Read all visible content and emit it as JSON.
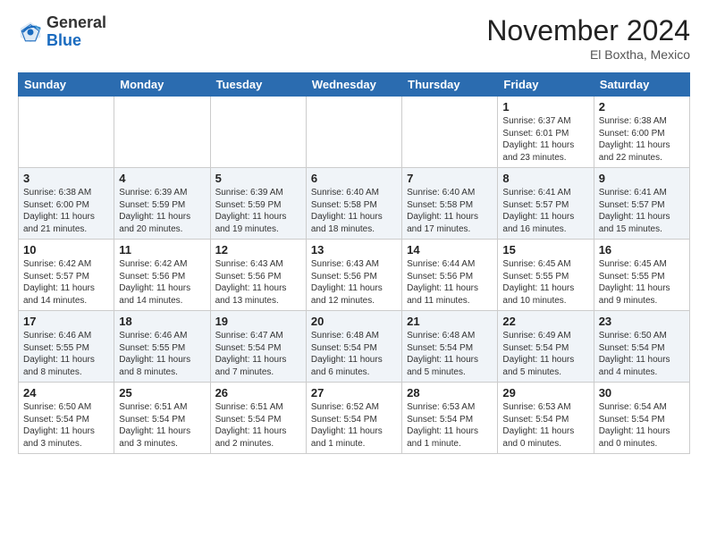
{
  "logo": {
    "general": "General",
    "blue": "Blue"
  },
  "header": {
    "month": "November 2024",
    "location": "El Boxtha, Mexico"
  },
  "weekdays": [
    "Sunday",
    "Monday",
    "Tuesday",
    "Wednesday",
    "Thursday",
    "Friday",
    "Saturday"
  ],
  "weeks": [
    [
      {
        "day": "",
        "info": ""
      },
      {
        "day": "",
        "info": ""
      },
      {
        "day": "",
        "info": ""
      },
      {
        "day": "",
        "info": ""
      },
      {
        "day": "",
        "info": ""
      },
      {
        "day": "1",
        "info": "Sunrise: 6:37 AM\nSunset: 6:01 PM\nDaylight: 11 hours and 23 minutes."
      },
      {
        "day": "2",
        "info": "Sunrise: 6:38 AM\nSunset: 6:00 PM\nDaylight: 11 hours and 22 minutes."
      }
    ],
    [
      {
        "day": "3",
        "info": "Sunrise: 6:38 AM\nSunset: 6:00 PM\nDaylight: 11 hours and 21 minutes."
      },
      {
        "day": "4",
        "info": "Sunrise: 6:39 AM\nSunset: 5:59 PM\nDaylight: 11 hours and 20 minutes."
      },
      {
        "day": "5",
        "info": "Sunrise: 6:39 AM\nSunset: 5:59 PM\nDaylight: 11 hours and 19 minutes."
      },
      {
        "day": "6",
        "info": "Sunrise: 6:40 AM\nSunset: 5:58 PM\nDaylight: 11 hours and 18 minutes."
      },
      {
        "day": "7",
        "info": "Sunrise: 6:40 AM\nSunset: 5:58 PM\nDaylight: 11 hours and 17 minutes."
      },
      {
        "day": "8",
        "info": "Sunrise: 6:41 AM\nSunset: 5:57 PM\nDaylight: 11 hours and 16 minutes."
      },
      {
        "day": "9",
        "info": "Sunrise: 6:41 AM\nSunset: 5:57 PM\nDaylight: 11 hours and 15 minutes."
      }
    ],
    [
      {
        "day": "10",
        "info": "Sunrise: 6:42 AM\nSunset: 5:57 PM\nDaylight: 11 hours and 14 minutes."
      },
      {
        "day": "11",
        "info": "Sunrise: 6:42 AM\nSunset: 5:56 PM\nDaylight: 11 hours and 14 minutes."
      },
      {
        "day": "12",
        "info": "Sunrise: 6:43 AM\nSunset: 5:56 PM\nDaylight: 11 hours and 13 minutes."
      },
      {
        "day": "13",
        "info": "Sunrise: 6:43 AM\nSunset: 5:56 PM\nDaylight: 11 hours and 12 minutes."
      },
      {
        "day": "14",
        "info": "Sunrise: 6:44 AM\nSunset: 5:56 PM\nDaylight: 11 hours and 11 minutes."
      },
      {
        "day": "15",
        "info": "Sunrise: 6:45 AM\nSunset: 5:55 PM\nDaylight: 11 hours and 10 minutes."
      },
      {
        "day": "16",
        "info": "Sunrise: 6:45 AM\nSunset: 5:55 PM\nDaylight: 11 hours and 9 minutes."
      }
    ],
    [
      {
        "day": "17",
        "info": "Sunrise: 6:46 AM\nSunset: 5:55 PM\nDaylight: 11 hours and 8 minutes."
      },
      {
        "day": "18",
        "info": "Sunrise: 6:46 AM\nSunset: 5:55 PM\nDaylight: 11 hours and 8 minutes."
      },
      {
        "day": "19",
        "info": "Sunrise: 6:47 AM\nSunset: 5:54 PM\nDaylight: 11 hours and 7 minutes."
      },
      {
        "day": "20",
        "info": "Sunrise: 6:48 AM\nSunset: 5:54 PM\nDaylight: 11 hours and 6 minutes."
      },
      {
        "day": "21",
        "info": "Sunrise: 6:48 AM\nSunset: 5:54 PM\nDaylight: 11 hours and 5 minutes."
      },
      {
        "day": "22",
        "info": "Sunrise: 6:49 AM\nSunset: 5:54 PM\nDaylight: 11 hours and 5 minutes."
      },
      {
        "day": "23",
        "info": "Sunrise: 6:50 AM\nSunset: 5:54 PM\nDaylight: 11 hours and 4 minutes."
      }
    ],
    [
      {
        "day": "24",
        "info": "Sunrise: 6:50 AM\nSunset: 5:54 PM\nDaylight: 11 hours and 3 minutes."
      },
      {
        "day": "25",
        "info": "Sunrise: 6:51 AM\nSunset: 5:54 PM\nDaylight: 11 hours and 3 minutes."
      },
      {
        "day": "26",
        "info": "Sunrise: 6:51 AM\nSunset: 5:54 PM\nDaylight: 11 hours and 2 minutes."
      },
      {
        "day": "27",
        "info": "Sunrise: 6:52 AM\nSunset: 5:54 PM\nDaylight: 11 hours and 1 minute."
      },
      {
        "day": "28",
        "info": "Sunrise: 6:53 AM\nSunset: 5:54 PM\nDaylight: 11 hours and 1 minute."
      },
      {
        "day": "29",
        "info": "Sunrise: 6:53 AM\nSunset: 5:54 PM\nDaylight: 11 hours and 0 minutes."
      },
      {
        "day": "30",
        "info": "Sunrise: 6:54 AM\nSunset: 5:54 PM\nDaylight: 11 hours and 0 minutes."
      }
    ]
  ]
}
